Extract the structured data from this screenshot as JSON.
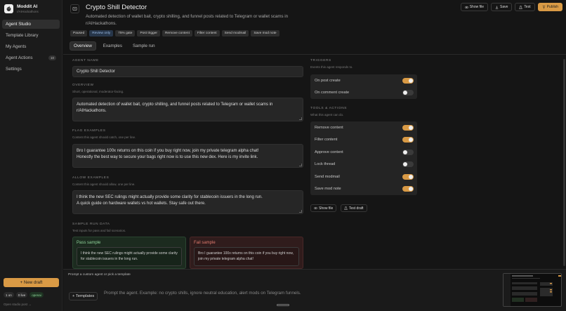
{
  "app": {
    "name": "Moddit AI",
    "handle": "r/AIHackathons"
  },
  "sidebar": {
    "items": [
      {
        "label": "Agent Studio",
        "active": true,
        "count": ""
      },
      {
        "label": "Template Library",
        "active": false,
        "count": ""
      },
      {
        "label": "My Agents",
        "active": false,
        "count": ""
      },
      {
        "label": "Agent Actions",
        "active": false,
        "count": "10"
      },
      {
        "label": "Settings",
        "active": false,
        "count": ""
      }
    ],
    "new_draft_label": "+ New draft",
    "chips": [
      {
        "label": "1 on",
        "green": false
      },
      {
        "label": "0 live",
        "green": false
      },
      {
        "label": "openai",
        "green": true
      }
    ],
    "studio_link": "Open studio post →"
  },
  "header": {
    "title": "Crypto Shill Detector",
    "subtitle": "Automated detection of wallet bait, crypto shilling, and funnel posts related to Telegram or wallet scams in r/AIHackathons.",
    "actions": [
      {
        "label": "Show file",
        "icon": "eye-icon",
        "primary": false
      },
      {
        "label": "Save",
        "icon": "download-icon",
        "primary": false
      },
      {
        "label": "Test",
        "icon": "flask-icon",
        "primary": false
      },
      {
        "label": "Publish",
        "icon": "upload-icon",
        "primary": true
      }
    ],
    "tags": [
      {
        "label": "Paused",
        "blue": false
      },
      {
        "label": "Review only",
        "blue": true
      },
      {
        "label": "75% gate",
        "blue": false
      },
      {
        "label": "Post trigger",
        "blue": false
      },
      {
        "label": "Remove content",
        "blue": false
      },
      {
        "label": "Filter content",
        "blue": false
      },
      {
        "label": "Send modmail",
        "blue": false
      },
      {
        "label": "Save mod note",
        "blue": false
      }
    ],
    "tabs": [
      {
        "label": "Overview",
        "active": true
      },
      {
        "label": "Examples",
        "active": false
      },
      {
        "label": "Sample run",
        "active": false
      }
    ]
  },
  "form": {
    "agent_name_label": "AGENT NAME",
    "agent_name": "Crypto Shill Detector",
    "overview_label": "OVERVIEW",
    "overview_sub": "Short, operational, moderator-facing.",
    "overview": "Automated detection of wallet bait, crypto shilling, and funnel posts related to Telegram or wallet scams in r/AIHackathons.",
    "flag_label": "FLAG EXAMPLES",
    "flag_sub": "Content this agent should catch, one per line.",
    "flag_examples": [
      "Bro I guarantee 100x returns on this coin if you buy right now, join my private telegram alpha chat!",
      "Honestly the best way to secure your bags right now is to use this new dex. Here is my invite link."
    ],
    "allow_label": "ALLOW EXAMPLES",
    "allow_sub": "Content this agent should allow, one per line.",
    "allow_examples": [
      "I think the new SEC rulings might actually provide some clarity for stablecoin issuers in the long run.",
      "A quick guide on hardware wallets vs hot wallets. Stay safe out there."
    ],
    "sample_label": "SAMPLE RUN DATA",
    "sample_sub": "Test inputs for pass and fail scenarios.",
    "pass_title": "Pass sample",
    "pass_text": "I think the new SEC rulings might actually provide some clarity for stablecoin issuers in the long run.",
    "fail_title": "Fail sample",
    "fail_text": "Bro I guarantee 100x returns on this coin if you buy right now, join my private telegram alpha chat!"
  },
  "triggers": {
    "label": "TRIGGERS",
    "sub": "Events this agent responds to.",
    "items": [
      {
        "label": "On post create",
        "on": true
      },
      {
        "label": "On comment create",
        "on": false
      }
    ]
  },
  "tools": {
    "label": "TOOLS & ACTIONS",
    "sub": "What this agent can do.",
    "items": [
      {
        "label": "Remove content",
        "on": true
      },
      {
        "label": "Filter content",
        "on": true
      },
      {
        "label": "Approve content",
        "on": false
      },
      {
        "label": "Lock thread",
        "on": false
      },
      {
        "label": "Send modmail",
        "on": true
      },
      {
        "label": "Save mod note",
        "on": true
      }
    ],
    "show_file_label": "Show file",
    "test_draft_label": "Test draft"
  },
  "prompt": {
    "hint": "Prompt a custom agent or pick a template",
    "templates_label": "+ Templates",
    "placeholder": "Prompt the agent. Example: no crypto shills, ignore neutral education, alert mods on Telegram funnels."
  },
  "colors": {
    "accent": "#d99a45",
    "bg": "#151515",
    "pass": "#8fd39a",
    "fail": "#e07b6e"
  }
}
